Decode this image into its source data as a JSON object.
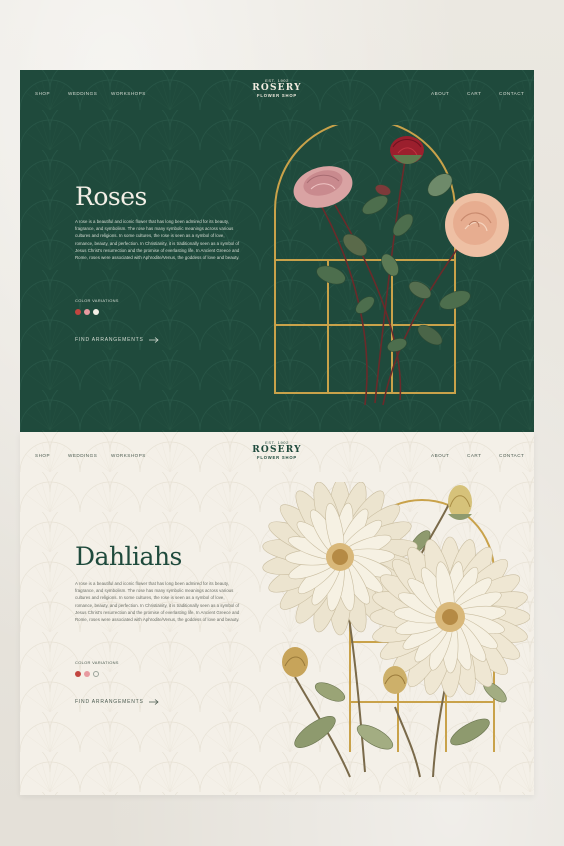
{
  "brand": {
    "est": "EST. 1902",
    "name": "ROSERY",
    "sub": "FLOWER SHOP"
  },
  "nav": {
    "shop": "SHOP",
    "weddings": "WEDDINGS",
    "workshops": "WORKSHOPS",
    "about": "ABOUT",
    "cart": "CART",
    "contact": "CONTACT"
  },
  "roses": {
    "title": "Roses",
    "description": "A rose is a beautiful and iconic flower that has long been admired for its beauty, fragrance, and symbolism. The rose has many symbolic meanings across various cultures and religions. In some cultures, the rose is seen as a symbol of love, romance, beauty, and perfection. In Christianity, it is traditionally seen as a symbol of Jesus Christ's resurrection and the promise of everlasting life. In Ancient Greece and Rome, roses were associated with Aphrodite/Venus, the goddess of love and beauty.",
    "color_variations_label": "COLOR VARIATIONS",
    "swatches": [
      "#c2453f",
      "#e89aa0",
      "#f4efe6"
    ],
    "cta": "FIND ARRANGEMENTS"
  },
  "dahlias": {
    "title": "Dahliahs",
    "description": "A rose is a beautiful and iconic flower that has long been admired for its beauty, fragrance, and symbolism. The rose has many symbolic meanings across various cultures and religions. In some cultures, the rose is seen as a symbol of love, romance, beauty, and perfection. In Christianity, it is traditionally seen as a symbol of Jesus Christ's resurrection and the promise of everlasting life. In Ancient Greece and Rome, roses were associated with Aphrodite/Venus, the goddess of love and beauty.",
    "color_variations_label": "COLOR VARIATIONS",
    "swatches": [
      "#c2453f",
      "#e89aa0",
      "#f4f0e8"
    ],
    "cta": "FIND ARRANGEMENTS"
  },
  "colors": {
    "forest_green": "#1f4a3c",
    "cream": "#f4f0e8",
    "gold": "#c9a24a"
  },
  "icons": {
    "cta_arrow": "arrow-right-icon",
    "logo_mark": "rose-icon"
  }
}
